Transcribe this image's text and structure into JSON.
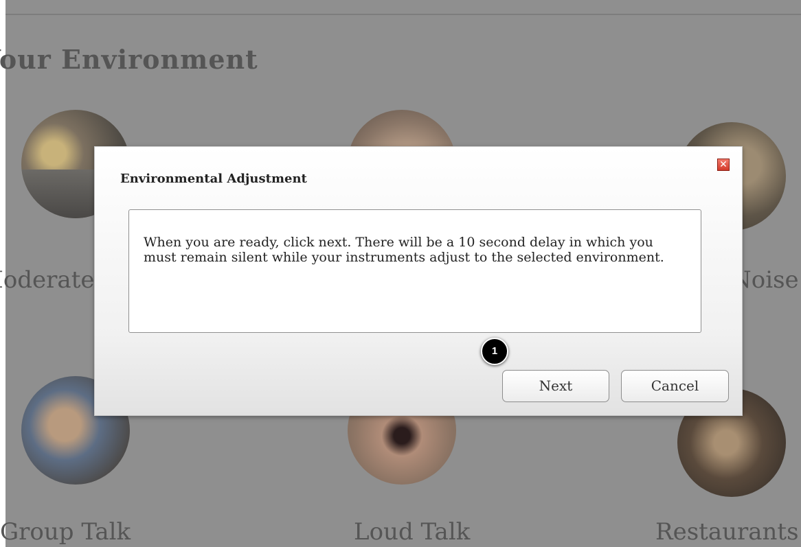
{
  "page": {
    "title": "Your Environment",
    "categories": [
      {
        "label": "Moderate"
      },
      {
        "label": "Noise"
      },
      {
        "label": "Group Talk"
      },
      {
        "label": "Loud Talk"
      },
      {
        "label": "Restaurants"
      }
    ]
  },
  "dialog": {
    "title": "Environmental Adjustment",
    "message": "When you are ready, click next. There will be a 10 second delay in which you must remain silent while your instruments adjust to the selected environment.",
    "next_label": "Next",
    "cancel_label": "Cancel",
    "close_icon": "close-icon"
  },
  "annotation": {
    "step_number": "1"
  },
  "colors": {
    "overlay": "#8f8f8f",
    "close_button": "#d33a2a",
    "badge": "#000000"
  }
}
